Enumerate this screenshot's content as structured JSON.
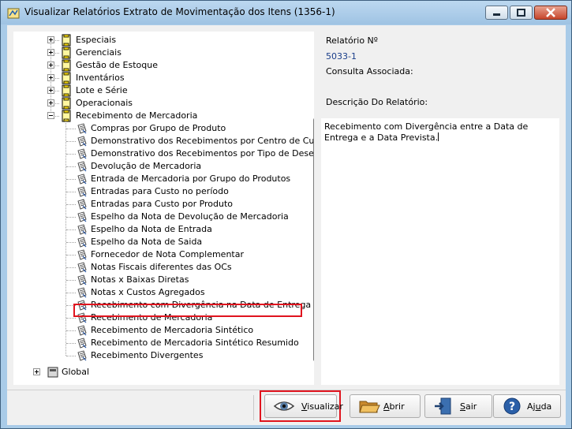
{
  "window": {
    "title": "Visualizar Relatórios Extrato de Movimentação dos Itens (1356-1)"
  },
  "tree": {
    "top_items": [
      {
        "label": "Especiais",
        "expanded": false
      },
      {
        "label": "Gerenciais",
        "expanded": false
      },
      {
        "label": "Gestão de Estoque",
        "expanded": false
      },
      {
        "label": "Inventários",
        "expanded": false
      },
      {
        "label": "Lote e Série",
        "expanded": false
      },
      {
        "label": "Operacionais",
        "expanded": false
      },
      {
        "label": "Recebimento de Mercadoria",
        "expanded": true
      }
    ],
    "children": [
      "Compras por Grupo de Produto",
      "Demonstrativo dos Recebimentos por Centro de Custo",
      "Demonstrativo dos Recebimentos por Tipo de Desembolso",
      "Devolução de Mercadoria",
      "Entrada de Mercadoria por Grupo do Produtos",
      "Entradas para Custo no período",
      "Entradas para Custo por Produto",
      "Espelho da Nota de Devolução de Mercadoria",
      "Espelho da Nota de Entrada",
      "Espelho da Nota de Saida",
      "Fornecedor de Nota Complementar",
      "Notas Fiscais diferentes das OCs",
      "Notas x Baixas Diretas",
      "Notas x Custos Agregados",
      "Recebimento com Divergência na Data de Entrega",
      "Recebimento de Mercadoria",
      "Recebimento de Mercadoria Sintético",
      "Recebimento de Mercadoria Sintético Resumido",
      "Recebimento Divergentes"
    ],
    "selected_child_index": 14,
    "bottom_item": {
      "label": "Global",
      "expanded": false
    }
  },
  "details": {
    "report_number_label": "Relatório Nº",
    "report_number_value": "5033-1",
    "query_label": "Consulta Associada:",
    "description_label": "Descrição Do Relatório:",
    "description_text": "Recebimento com Divergência entre a Data de Entrega e a Data Prevista."
  },
  "buttons": {
    "visualizar": {
      "first": "V",
      "rest": "isualizar"
    },
    "abrir": {
      "first": "A",
      "rest": "brir"
    },
    "sair": {
      "first": "S",
      "rest": "air"
    },
    "ajuda": {
      "pre": "Aj",
      "u": "u",
      "post": "da"
    }
  },
  "icons": {
    "tree_folder": "bookshelf-folder-icon",
    "tree_leaf": "report-doc-icon",
    "visualizar": "eye-icon",
    "abrir": "open-folder-icon",
    "sair": "exit-door-icon",
    "ajuda": "help-question-icon"
  }
}
